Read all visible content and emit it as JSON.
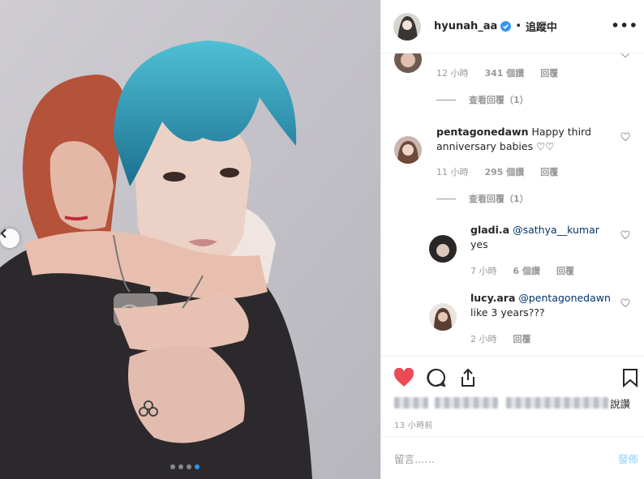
{
  "header": {
    "username": "hyunah_aa",
    "separator": "•",
    "following_label": "追蹤中",
    "more_label": "•••"
  },
  "comments": {
    "first": {
      "time": "12 小時",
      "likes": "341 個讚",
      "reply": "回覆",
      "view_replies": "查看回覆（1）"
    },
    "second": {
      "username": "pentagonedawn",
      "text_line1": "Happy third",
      "text_line2": "anniversary babies ♡♡",
      "time": "11 小時",
      "likes": "295 個讚",
      "reply": "回覆",
      "view_replies": "查看回覆（1）"
    },
    "reply1": {
      "username": "gladi.a",
      "mention": "@sathya__kumar",
      "text": "yes",
      "time": "7 小時",
      "likes": "6 個讚",
      "reply": "回覆"
    },
    "reply2": {
      "username": "lucy.ara",
      "mention": "@pentagonedawn",
      "text": "like 3 years???",
      "time": "2 小時",
      "reply": "回覆"
    }
  },
  "actions": {
    "likes_tail": "說讚",
    "time_ago": "13 小時前"
  },
  "add_comment": {
    "placeholder": "留言……",
    "post_label": "發佈"
  },
  "carousel": {
    "dot_count": 4,
    "active_dot": 4
  },
  "colors": {
    "like_red": "#ed4956",
    "link_blue": "#003569",
    "verified_blue": "#3897f0",
    "post_disabled": "#b2dffc",
    "active_dot": "#2c94f0"
  },
  "icons": [
    "heart-filled-icon",
    "comment-icon",
    "share-icon",
    "bookmark-icon",
    "verified-badge-icon",
    "chevron-left-icon",
    "heart-outline-icon"
  ]
}
